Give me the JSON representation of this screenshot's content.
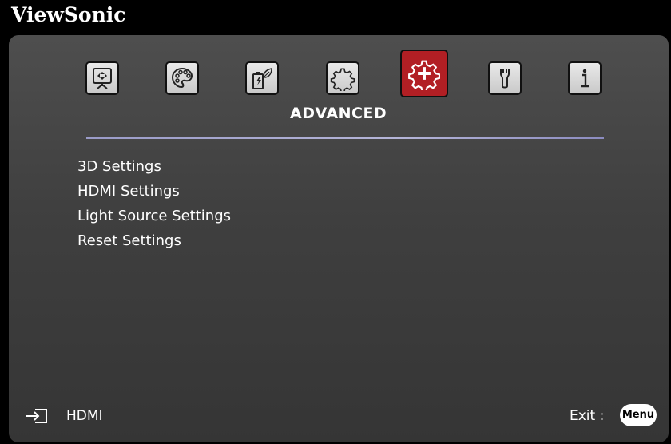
{
  "brand": {
    "name": "ViewSonic"
  },
  "tabs": [
    {
      "name": "display-tab",
      "icon": "projector-screen-icon",
      "active": false
    },
    {
      "name": "image-tab",
      "icon": "palette-icon",
      "active": false
    },
    {
      "name": "power-tab",
      "icon": "battery-leaf-icon",
      "active": false
    },
    {
      "name": "basic-tab",
      "icon": "gear-icon",
      "active": false
    },
    {
      "name": "advanced-tab",
      "icon": "gear-plus-icon",
      "active": true
    },
    {
      "name": "system-tab",
      "icon": "wrench-icon",
      "active": false
    },
    {
      "name": "information-tab",
      "icon": "info-icon",
      "active": false
    }
  ],
  "section": {
    "title": "ADVANCED"
  },
  "menu": {
    "items": [
      "3D Settings",
      "HDMI Settings",
      "Light Source Settings",
      "Reset Settings"
    ]
  },
  "footer": {
    "source_icon": "input-source-icon",
    "source_label": "HDMI",
    "exit_label": "Exit :",
    "menu_button": "Menu"
  },
  "colors": {
    "active_tab": "#b21f24",
    "divider": "#a8a8d0",
    "panel": "#444444"
  }
}
